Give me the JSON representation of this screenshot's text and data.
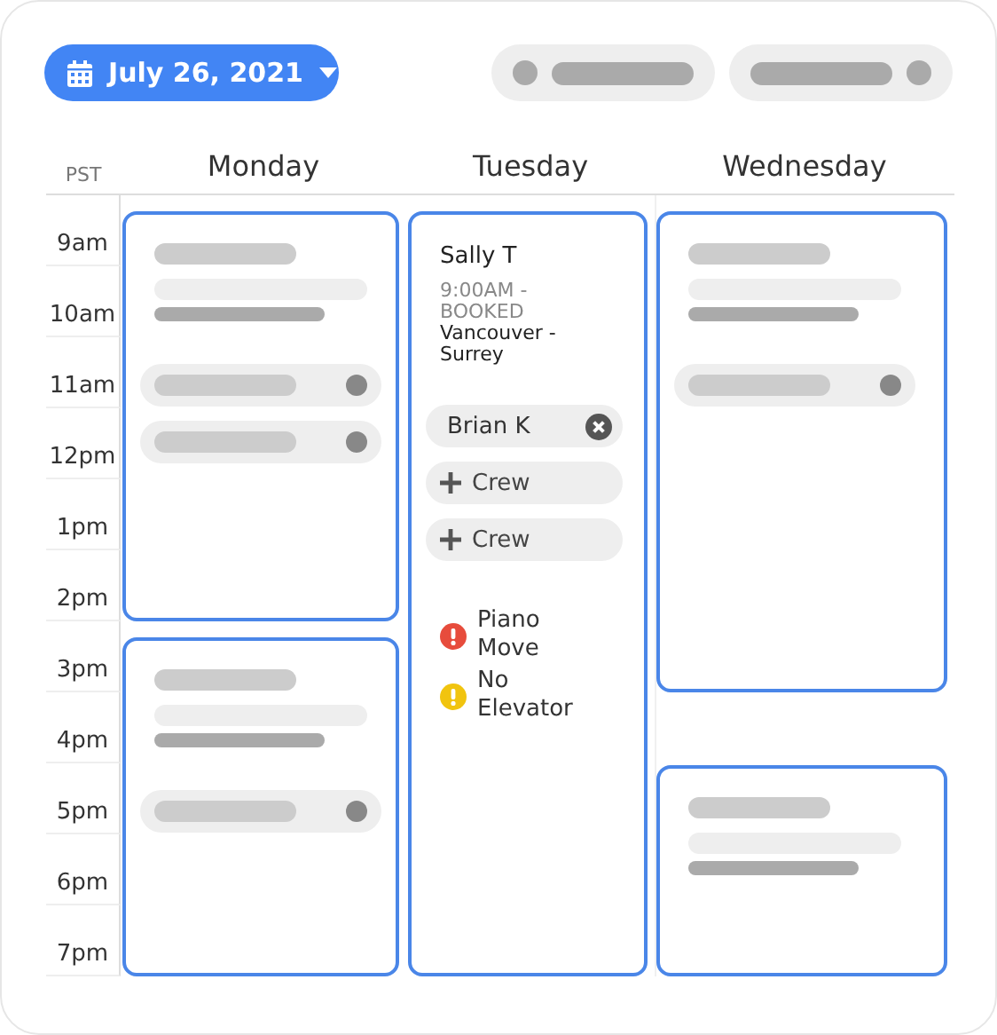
{
  "date_button": {
    "label": "July 26, 2021"
  },
  "filters": [
    {
      "kind": "dot-first"
    },
    {
      "kind": "dot-last"
    }
  ],
  "timezone": "PST",
  "hours": [
    "9am",
    "10am",
    "11am",
    "12pm",
    "1pm",
    "2pm",
    "3pm",
    "4pm",
    "5pm",
    "6pm",
    "7pm"
  ],
  "days": [
    {
      "label": "Monday",
      "events": [
        {
          "kind": "skeleton",
          "chips": [
            {
              "kind": "skeleton"
            },
            {
              "kind": "skeleton"
            }
          ]
        },
        {
          "kind": "skeleton",
          "chips": [
            {
              "kind": "skeleton"
            }
          ]
        }
      ]
    },
    {
      "label": "Tuesday",
      "events": [
        {
          "kind": "booking",
          "customer": "Sally T",
          "status": "9:00AM - BOOKED",
          "route": "Vancouver - Surrey",
          "crew": [
            {
              "kind": "assigned",
              "name": "Brian K"
            },
            {
              "kind": "add",
              "name": "Crew"
            },
            {
              "kind": "add",
              "name": "Crew"
            }
          ],
          "alerts": [
            {
              "text": "Piano Move",
              "color": "#e74c3c"
            },
            {
              "text": "No Elevator",
              "color": "#f1c40f"
            }
          ]
        }
      ]
    },
    {
      "label": "Wednesday",
      "events": [
        {
          "kind": "skeleton",
          "chips": [
            {
              "kind": "skeleton"
            }
          ]
        },
        {
          "kind": "skeleton"
        }
      ]
    }
  ]
}
